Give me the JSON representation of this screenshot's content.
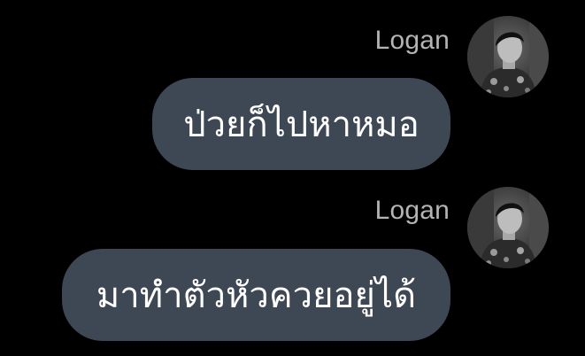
{
  "chat": {
    "messages": [
      {
        "sender": "Logan",
        "avatar_icon": "profile-photo-icon",
        "text": "ป่วยก็ไปหาหมอ"
      },
      {
        "sender": "Logan",
        "avatar_icon": "profile-photo-icon",
        "text": "มาทำตัวหัวควยอยู่ได้"
      }
    ]
  },
  "colors": {
    "background": "#000000",
    "bubble": "#3e4754",
    "bubble_text": "#ffffff",
    "sender_name": "#b4b4b4"
  }
}
